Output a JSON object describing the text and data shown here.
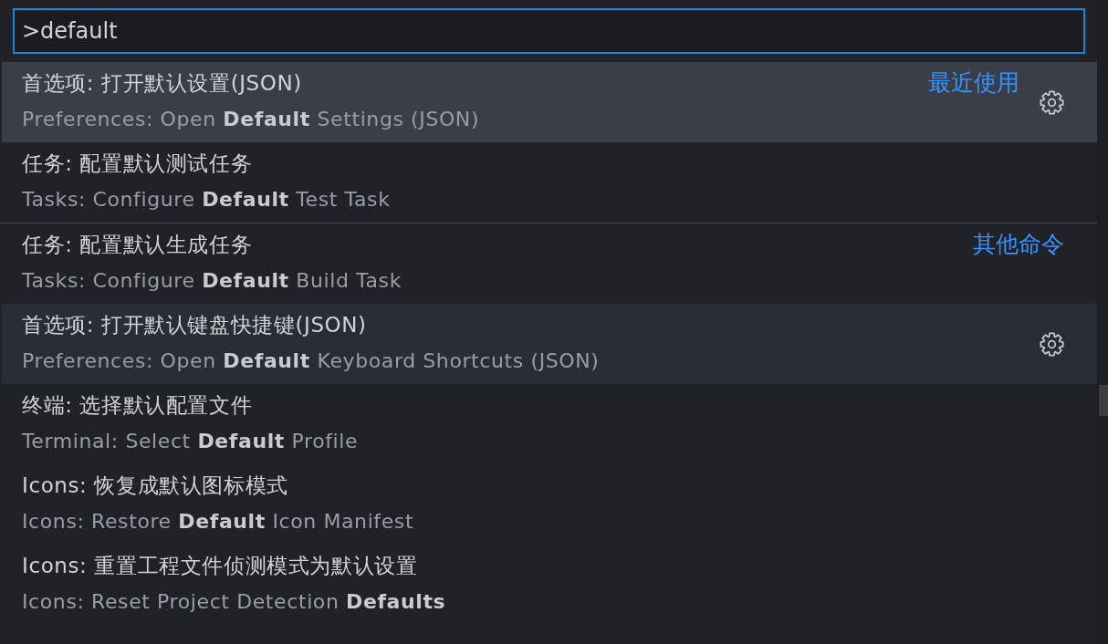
{
  "search": {
    "value": ">default"
  },
  "groups": [
    {
      "label": "最近使用",
      "items": [
        {
          "title": "首选项: 打开默认设置(JSON)",
          "subtitle": "Preferences: Open **Default** Settings (JSON)",
          "selected": true,
          "hovered": false
        },
        {
          "title": "任务: 配置默认测试任务",
          "subtitle": "Tasks: Configure **Default** Test Task",
          "selected": false,
          "hovered": false
        }
      ]
    },
    {
      "label": "其他命令",
      "items": [
        {
          "title": "任务: 配置默认生成任务",
          "subtitle": "Tasks: Configure **Default** Build Task",
          "selected": false,
          "hovered": false
        },
        {
          "title": "首选项: 打开默认键盘快捷键(JSON)",
          "subtitle": "Preferences: Open **Default** Keyboard Shortcuts (JSON)",
          "selected": false,
          "hovered": true
        },
        {
          "title": "终端: 选择默认配置文件",
          "subtitle": "Terminal: Select **Default** Profile",
          "selected": false,
          "hovered": false
        },
        {
          "title": "Icons: 恢复成默认图标模式",
          "subtitle": "Icons: Restore **Default** Icon Manifest",
          "selected": false,
          "hovered": false
        },
        {
          "title": "Icons: 重置工程文件侦测模式为默认设置",
          "subtitle": "Icons: Reset Project Detection **Defaults**",
          "selected": false,
          "hovered": false
        }
      ]
    }
  ]
}
